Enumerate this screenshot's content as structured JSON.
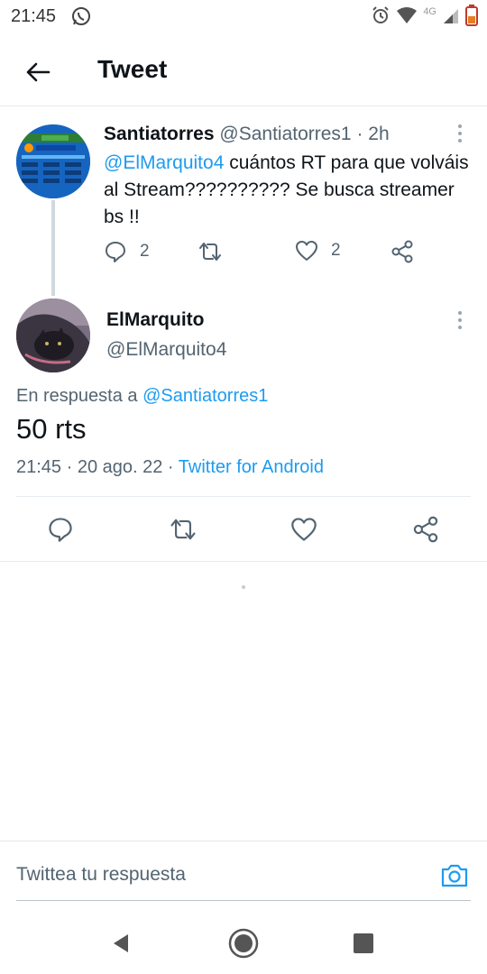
{
  "status_bar": {
    "time": "21:45",
    "network": "4G",
    "icons": [
      "whatsapp-icon",
      "alarm-icon",
      "wifi-icon",
      "signal-icon",
      "battery-icon"
    ]
  },
  "header": {
    "title": "Tweet",
    "back_icon": "arrow-left-icon"
  },
  "parent_tweet": {
    "name": "Santiatorres",
    "handle": "@Santiatorres1",
    "time": "· 2h",
    "mention": "@ElMarquito4",
    "text": " cuántos RT para que volváis al Stream?????????? Se busca streamer bs !!",
    "reply_count": "2",
    "like_count": "2"
  },
  "reply_tweet": {
    "name": "ElMarquito",
    "handle": "@ElMarquito4",
    "reply_prefix": "En respuesta a ",
    "reply_to": "@Santiatorres1",
    "text": "50 rts",
    "timestamp": "21:45 · 20 ago. 22 · ",
    "client": "Twitter for Android"
  },
  "compose": {
    "placeholder": "Twittea tu respuesta"
  },
  "colors": {
    "accent": "#1d9bf0",
    "text": "#0f1419",
    "muted": "#536471",
    "divider": "#e6ecf0"
  }
}
